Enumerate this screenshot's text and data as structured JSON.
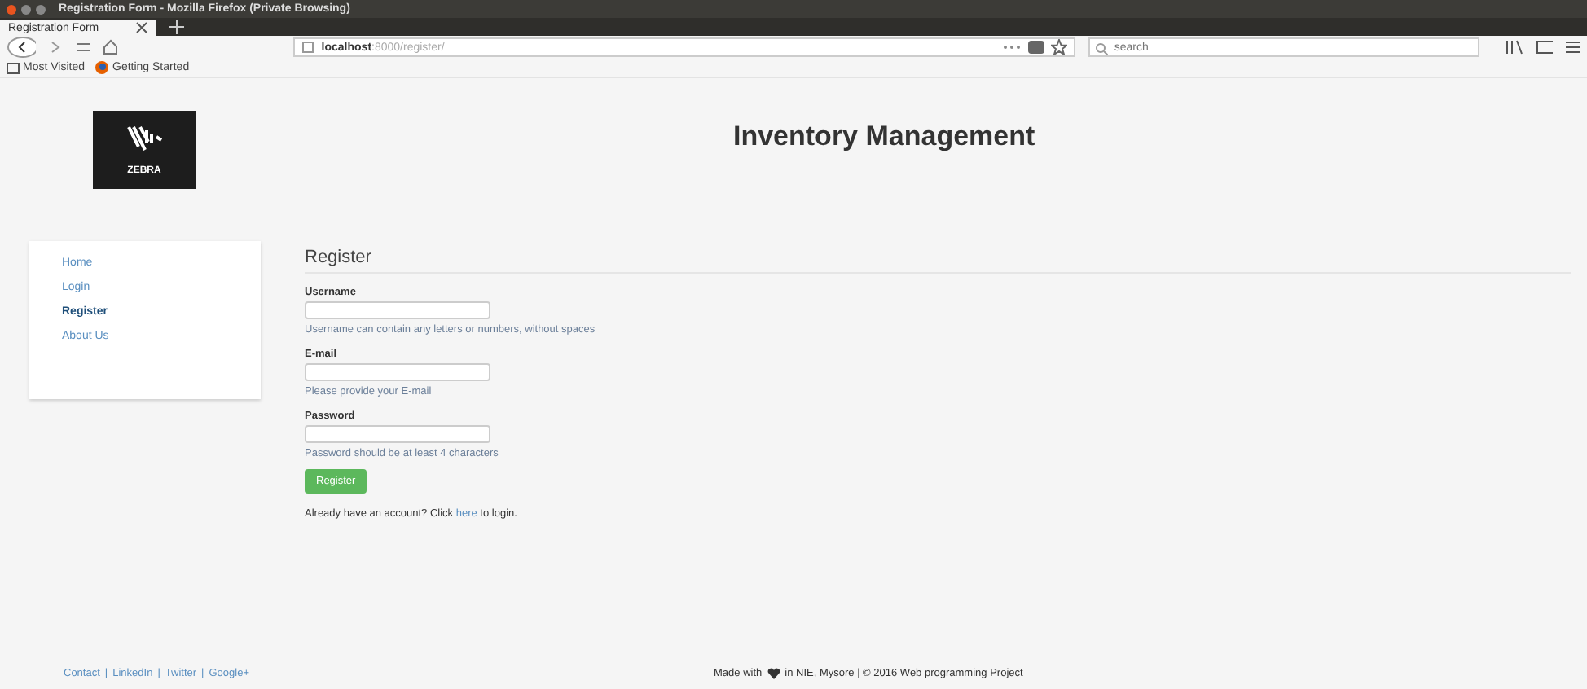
{
  "window": {
    "title": "Registration Form - Mozilla Firefox (Private Browsing)"
  },
  "tabs": [
    {
      "label": "Registration Form",
      "selected": true
    }
  ],
  "address_bar": {
    "host": "localhost",
    "path": ":8000/register/"
  },
  "search": {
    "placeholder": "search"
  },
  "bookmarks": [
    {
      "label": "Most Visited",
      "kind": "folder"
    },
    {
      "label": "Getting Started",
      "kind": "firefox"
    }
  ],
  "logo": {
    "text": "ZEBRA"
  },
  "header": {
    "title": "Inventory Management"
  },
  "sidebar": {
    "items": [
      {
        "label": "Home",
        "selected": false
      },
      {
        "label": "Login",
        "selected": false
      },
      {
        "label": "Register",
        "selected": true
      },
      {
        "label": "About Us",
        "selected": false
      }
    ]
  },
  "form": {
    "title": "Register",
    "fields": [
      {
        "label": "Username",
        "help": "Username can contain any letters or numbers, without spaces"
      },
      {
        "label": "E-mail",
        "help": "Please provide your E-mail"
      },
      {
        "label": "Password",
        "help": "Password should be at least 4 characters"
      }
    ],
    "submit": "Register",
    "login_prompt": {
      "before": "Already have an account? Click ",
      "link": "here",
      "after": " to login."
    }
  },
  "footer": {
    "links": [
      "Contact",
      "LinkedIn",
      "Twitter",
      "Google+"
    ],
    "separator": "|",
    "credit_before": "Made with",
    "credit_after": "in NIE, Mysore | © 2016 Web programming Project"
  }
}
